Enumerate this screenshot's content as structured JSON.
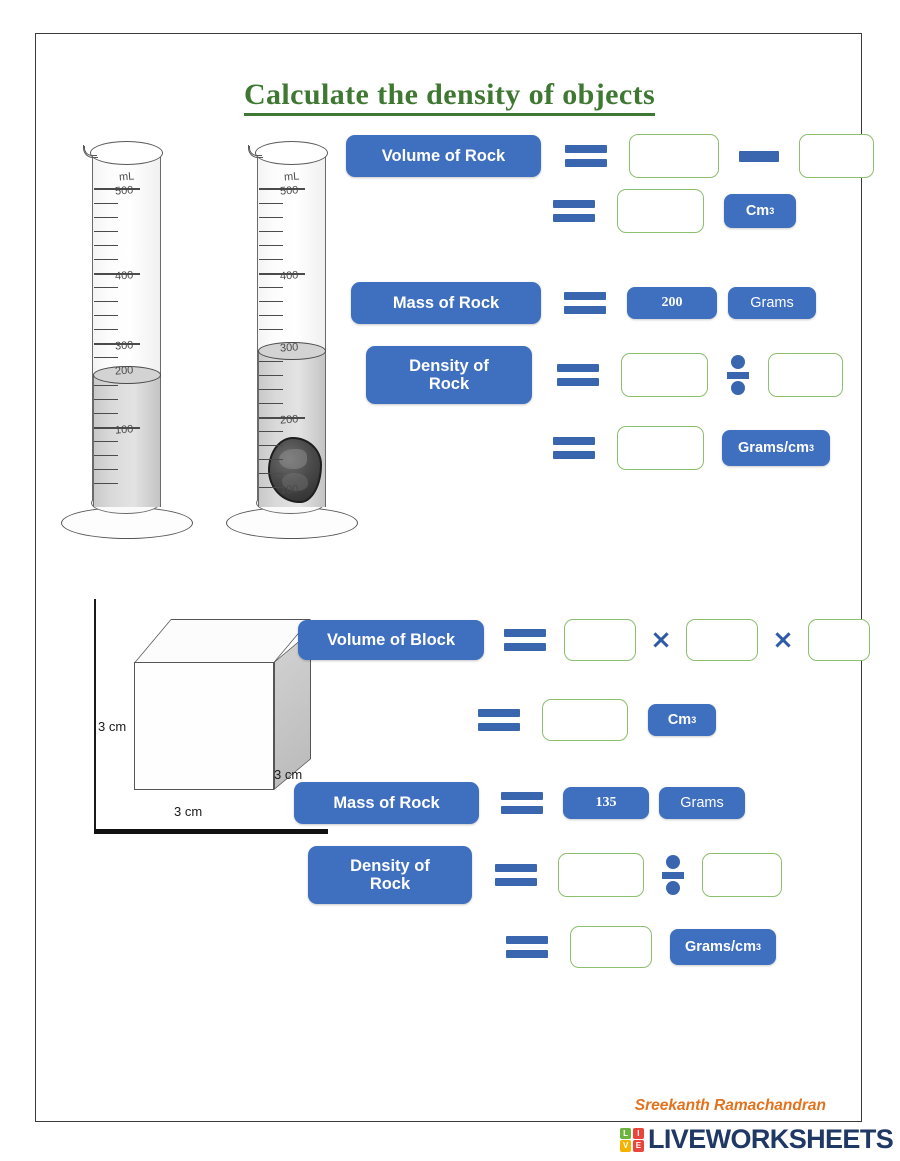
{
  "title": "Calculate the density of objects",
  "author": "Sreekanth Ramachandran",
  "brand": {
    "name": "LIVEWORKSHEETS",
    "logo_letters": [
      "L",
      "I",
      "V",
      "E"
    ],
    "text_color": "#1F3864",
    "accent_blue": "#3F6FBF",
    "accent_green_border": "#8CBF6E",
    "title_green": "#3F7833",
    "author_orange": "#E2721E"
  },
  "figures": {
    "cylinder_before": {
      "unit_label": "mL",
      "tick_labels": [
        "500",
        "400",
        "300",
        "200",
        "100"
      ],
      "water_level": "200",
      "has_rock": false
    },
    "cylinder_after": {
      "unit_label": "mL",
      "tick_labels": [
        "500",
        "400",
        "300",
        "200",
        "100"
      ],
      "water_level": "300",
      "has_rock": true
    },
    "block": {
      "height_label": "3 cm",
      "width_label": "3 cm",
      "depth_label": "3 cm"
    }
  },
  "section1": {
    "volume": {
      "label": "Volume of Rock",
      "equals": "=",
      "operand1": "",
      "operator": "-",
      "operand2": "",
      "result": "",
      "unit": "Cm",
      "unit_sup": "3"
    },
    "mass": {
      "label": "Mass of Rock",
      "equals": "=",
      "value": "200",
      "unit": "Grams"
    },
    "density": {
      "label": "Density of\nRock",
      "label_line1": "Density of",
      "label_line2": "Rock",
      "equals": "=",
      "numerator": "",
      "operator": "÷",
      "denominator": "",
      "result": "",
      "unit": "Grams/cm",
      "unit_sup": "3"
    }
  },
  "section2": {
    "volume": {
      "label": "Volume of Block",
      "equals": "=",
      "operand1": "",
      "operator1": "×",
      "operand2": "",
      "operator2": "×",
      "operand3": "",
      "result": "",
      "unit": "Cm",
      "unit_sup": "3"
    },
    "mass": {
      "label": "Mass of Rock",
      "equals": "=",
      "value": "135",
      "unit": "Grams"
    },
    "density": {
      "label_line1": "Density of",
      "label_line2": "Rock",
      "equals": "=",
      "numerator": "",
      "operator": "÷",
      "denominator": "",
      "result": "",
      "unit": "Grams/cm",
      "unit_sup": "3"
    }
  }
}
